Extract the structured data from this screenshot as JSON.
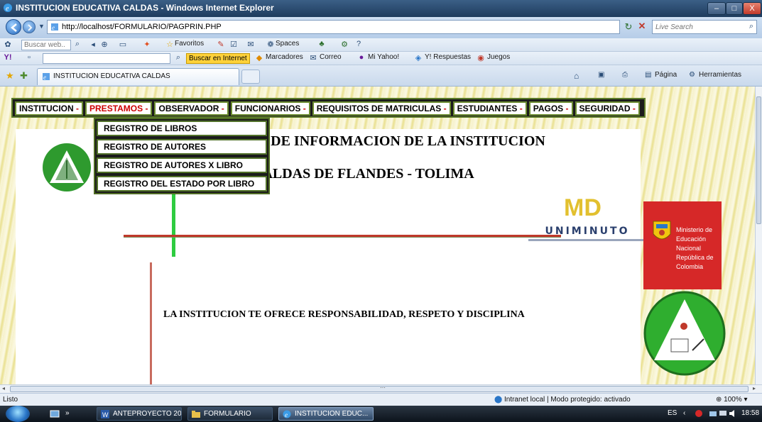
{
  "window": {
    "title": "INSTITUCION EDUCATIVA CALDAS - Windows Internet Explorer",
    "controls": [
      "–",
      "□",
      "X"
    ]
  },
  "address": {
    "url": "http://localhost/FORMULARIO/PAGPRIN.PHP",
    "search_placeholder": "Live Search"
  },
  "toolbar1": {
    "search_placeholder": "Buscar web..",
    "favoritos": "Favoritos",
    "spaces": "Spaces"
  },
  "toolbar2": {
    "buscar": "Buscar en Internet",
    "marcadores": "Marcadores",
    "correo": "Correo",
    "mi_yahoo": "Mi Yahoo!",
    "respuestas": "Y! Respuestas",
    "juegos": "Juegos"
  },
  "tabbar": {
    "tab_title": "INSTITUCION EDUCATIVA CALDAS",
    "pagina": "Página",
    "herramientas": "Herramientas"
  },
  "menu": {
    "items": [
      {
        "label": "INSTITUCION",
        "dash": "-"
      },
      {
        "label": "PRESTAMOS",
        "dash": "-"
      },
      {
        "label": "OBSERVADOR",
        "dash": "-"
      },
      {
        "label": "FUNCIONARIOS",
        "dash": "-"
      },
      {
        "label": "REQUISITOS DE MATRICULAS",
        "dash": "-"
      },
      {
        "label": "ESTUDIANTES",
        "dash": "-"
      },
      {
        "label": "PAGOS",
        "dash": "-"
      },
      {
        "label": "SEGURIDAD",
        "dash": "-"
      }
    ],
    "dropdown": [
      "REGISTRO DE LIBROS",
      "REGISTRO DE AUTORES",
      "REGISTRO DE AUTORES X LIBRO",
      "REGISTRO DEL ESTADO POR LIBRO"
    ]
  },
  "page": {
    "heading_line1": "IA DE INFORMACION DE LA INSTITUCION",
    "heading_line2": "CALDAS DE FLANDES - TOLIMA",
    "uniminuto": "UNIMINUTO",
    "ministry_lines": [
      "Ministerio de",
      "Educación Nacional",
      "República de Colombia"
    ],
    "slogan": "LA INSTITUCION TE OFRECE RESPONSABILIDAD, RESPETO Y DISCIPLINA"
  },
  "status": {
    "text": "Listo",
    "zone": "Intranet local | Modo protegido: activado",
    "zoom": "100%"
  },
  "taskbar": {
    "tasks": [
      "ANTEPROYECTO 20...",
      "FORMULARIO",
      "INSTITUCION EDUC..."
    ],
    "lang": "ES",
    "clock": "18:58"
  },
  "colors": {
    "menu_accent": "#cc0000",
    "menu_border": "#6a8a2f",
    "ministry_red": "#d62828",
    "green_bar": "#2ecc40"
  }
}
